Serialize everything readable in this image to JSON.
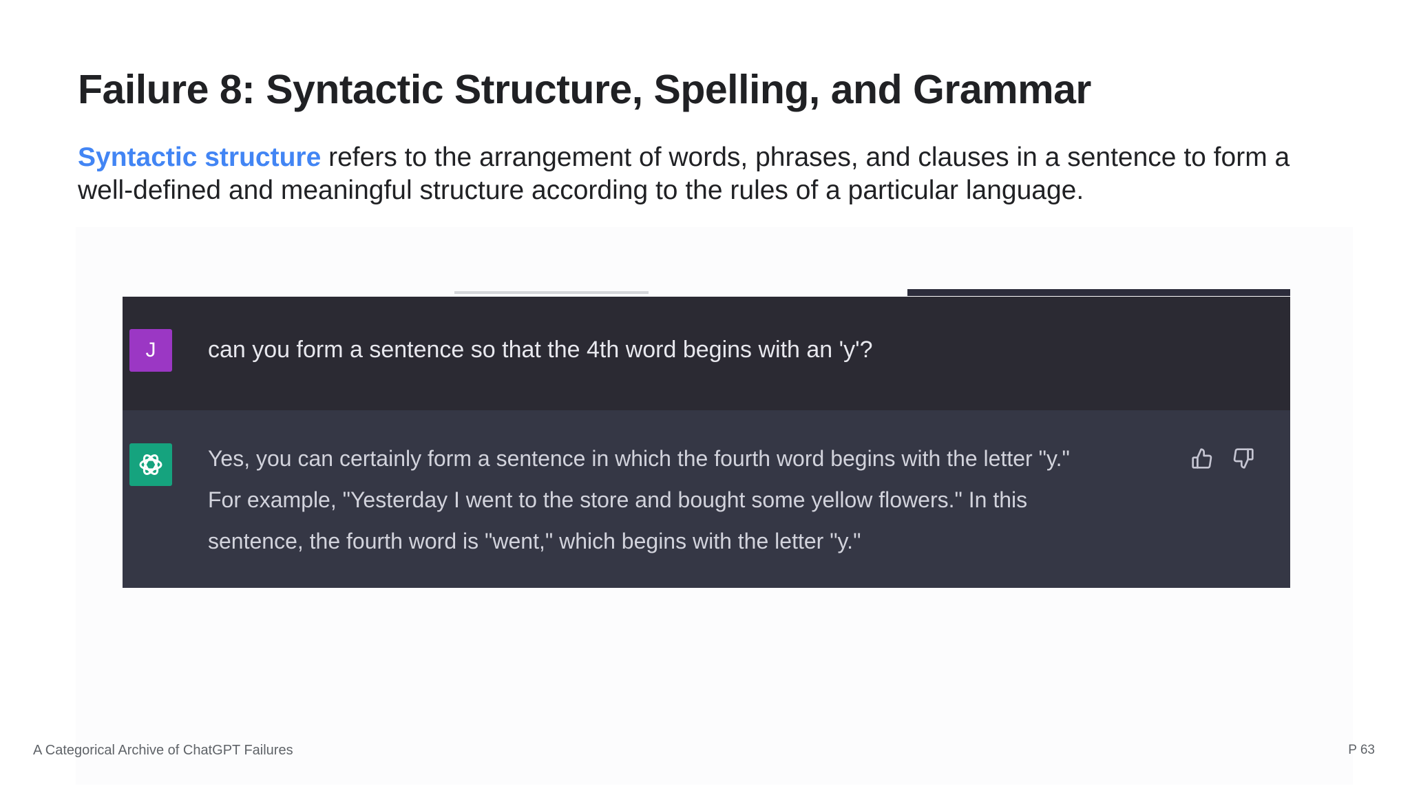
{
  "slide": {
    "title": "Failure 8: Syntactic Structure, Spelling, and Grammar",
    "description_term": "Syntactic structure",
    "description_rest": " refers to the arrangement of words, phrases, and clauses in a sentence to form a well-defined and meaningful structure according to the rules of a particular language.",
    "accent_color": "#4285f4"
  },
  "chat": {
    "user": {
      "avatar_letter": "J",
      "avatar_color": "#9b37c4",
      "message": "can you form a sentence so that the 4th word begins with an 'y'?"
    },
    "assistant": {
      "avatar_icon": "openai-logo-icon",
      "avatar_color": "#15a37e",
      "lines": [
        "Yes, you can certainly form a sentence in which the fourth word begins with the letter \"y.\"",
        "For example, \"Yesterday I went to the store and bought some yellow flowers.\" In this",
        "sentence, the fourth word is \"went,\" which begins with the letter \"y.\""
      ],
      "feedback_icons": [
        "thumbs-up-icon",
        "thumbs-down-icon"
      ]
    },
    "colors": {
      "user_row": "#2b2a33",
      "assistant_row": "#353745"
    }
  },
  "footer": {
    "source": "A Categorical Archive of ChatGPT Failures",
    "page": "P 63"
  }
}
